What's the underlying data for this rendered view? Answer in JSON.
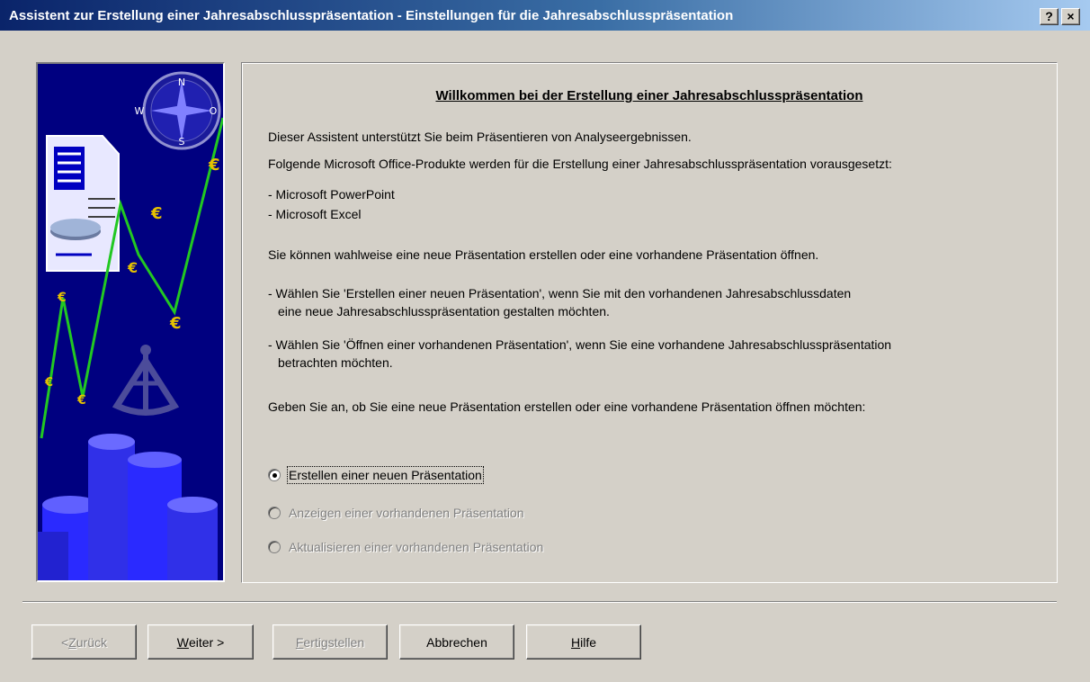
{
  "window": {
    "title": "Assistent zur Erstellung einer Jahresabschlusspräsentation - Einstellungen für die Jahresabschlusspräsentation",
    "help_button": "?",
    "close_button": "×"
  },
  "banner": {
    "compass_letters": {
      "n": "N",
      "w": "W",
      "o": "O",
      "s": "S"
    },
    "currency_symbol": "€"
  },
  "content": {
    "heading": "Willkommen bei der Erstellung einer Jahresabschlusspräsentation",
    "intro_1": "Dieser Assistent unterstützt Sie beim Präsentieren von Analyseergebnissen.",
    "intro_2": "Folgende Microsoft Office-Produkte werden für die Erstellung einer Jahresabschlusspräsentation vorausgesetzt:",
    "products": [
      "- Microsoft PowerPoint",
      "- Microsoft Excel"
    ],
    "choice_text": "Sie können wahlweise eine neue Präsentation erstellen oder eine vorhandene Präsentation öffnen.",
    "option_create_line1": "-  Wählen Sie 'Erstellen einer neuen Präsentation', wenn Sie mit den vorhandenen Jahresabschlussdaten",
    "option_create_line2": "eine neue Jahresabschlusspräsentation gestalten möchten.",
    "option_open_line1": "-  Wählen Sie 'Öffnen einer vorhandenen Präsentation', wenn Sie eine vorhandene Jahresabschlusspräsentation",
    "option_open_line2": "betrachten möchten.",
    "prompt": "Geben Sie an, ob Sie eine neue Präsentation erstellen oder eine vorhandene Präsentation öffnen möchten:",
    "radios": [
      {
        "label": "Erstellen einer neuen Präsentation",
        "checked": true,
        "enabled": true
      },
      {
        "label": "Anzeigen einer vorhandenen Präsentation",
        "checked": false,
        "enabled": false
      },
      {
        "label": "Aktualisieren einer vorhandenen Präsentation",
        "checked": false,
        "enabled": false
      }
    ]
  },
  "buttons": {
    "back": {
      "prefix": "< ",
      "mnemonic": "Z",
      "rest": "urück",
      "enabled": false
    },
    "next": {
      "mnemonic": "W",
      "rest": "eiter >",
      "enabled": true
    },
    "finish": {
      "mnemonic": "F",
      "rest": "ertigstellen",
      "enabled": false
    },
    "cancel": {
      "label": "Abbrechen",
      "enabled": true
    },
    "help": {
      "mnemonic": "H",
      "rest": "ilfe",
      "enabled": true
    }
  },
  "colors": {
    "title_bar_start": "#0a246a",
    "title_bar_end": "#a6caf0",
    "dialog_face": "#d4d0c8",
    "banner_background": "#000080",
    "chart_line": "#22c822",
    "coin": "#2a2aff"
  }
}
